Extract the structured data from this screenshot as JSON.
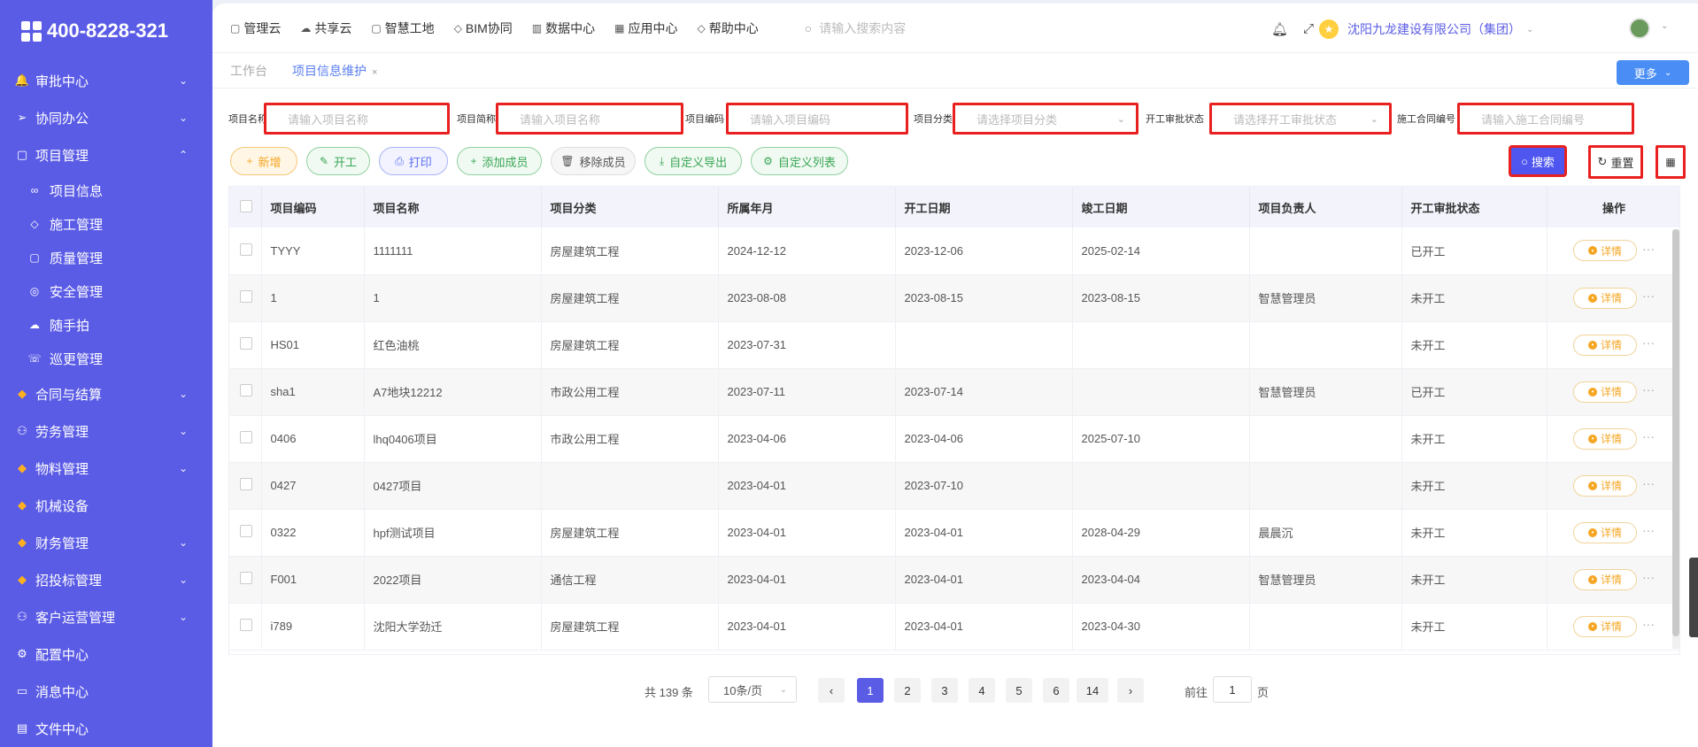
{
  "sidebar": {
    "logo_text": "400-8228-321",
    "menu": [
      {
        "label": "审批中心",
        "icon": "bell-icon",
        "glyph": "🔔",
        "chevron": "⌄"
      },
      {
        "label": "协同办公",
        "icon": "send-icon",
        "glyph": "➢",
        "chevron": "⌄"
      },
      {
        "label": "项目管理",
        "icon": "book-icon",
        "glyph": "▢",
        "chevron": "⌃"
      }
    ],
    "submenu": [
      {
        "label": "项目信息",
        "icon": "glasses-icon",
        "glyph": "∞"
      },
      {
        "label": "施工管理",
        "icon": "tag-icon",
        "glyph": "◇"
      },
      {
        "label": "质量管理",
        "icon": "book-icon",
        "glyph": "▢"
      },
      {
        "label": "安全管理",
        "icon": "location-icon",
        "glyph": "◎"
      },
      {
        "label": "随手拍",
        "icon": "cloud-icon",
        "glyph": "☁"
      },
      {
        "label": "巡更管理",
        "icon": "phone-icon",
        "glyph": "☏"
      }
    ],
    "menu2": [
      {
        "label": "合同与结算",
        "icon": "gem-icon",
        "glyph": "◆",
        "chevron": "⌄"
      },
      {
        "label": "劳务管理",
        "icon": "user-icon",
        "glyph": "⚇",
        "chevron": "⌄"
      },
      {
        "label": "物料管理",
        "icon": "gem-icon",
        "glyph": "◆",
        "chevron": "⌄"
      },
      {
        "label": "机械设备",
        "icon": "gem-icon",
        "glyph": "◆",
        "chevron": ""
      },
      {
        "label": "财务管理",
        "icon": "gem-icon",
        "glyph": "◆",
        "chevron": "⌄"
      },
      {
        "label": "招投标管理",
        "icon": "gem-icon",
        "glyph": "◆",
        "chevron": "⌄"
      },
      {
        "label": "客户运营管理",
        "icon": "user-icon",
        "glyph": "⚇",
        "chevron": "⌄"
      },
      {
        "label": "配置中心",
        "icon": "gear-icon",
        "glyph": "⚙",
        "chevron": ""
      },
      {
        "label": "消息中心",
        "icon": "message-icon",
        "glyph": "▭",
        "chevron": ""
      },
      {
        "label": "文件中心",
        "icon": "file-icon",
        "glyph": "▤",
        "chevron": ""
      }
    ]
  },
  "topnav": {
    "items": [
      "管理云",
      "共享云",
      "智慧工地",
      "BIM协同",
      "数据中心",
      "应用中心",
      "帮助中心"
    ],
    "search_placeholder": "请输入搜索内容",
    "company": "沈阳九龙建设有限公司（集团）"
  },
  "tabs": {
    "workbench": "工作台",
    "active": "项目信息维护",
    "more": "更多"
  },
  "filters": {
    "name_label": "项目名称",
    "name_ph": "请输入项目名称",
    "short_label": "项目简称",
    "short_ph": "请输入项目名称",
    "code_label": "项目编码",
    "code_ph": "请输入项目编码",
    "cat_label": "项目分类",
    "cat_ph": "请选择项目分类",
    "status_label": "开工审批状态",
    "status_ph": "请选择开工审批状态",
    "contract_label": "施工合同编号",
    "contract_ph": "请输入施工合同编号"
  },
  "actions": {
    "add": "新增",
    "start": "开工",
    "print": "打印",
    "add_member": "添加成员",
    "remove_member": "移除成员",
    "export": "自定义导出",
    "custom_list": "自定义列表",
    "search": "搜索",
    "reset": "重置"
  },
  "table": {
    "headers": [
      "项目编码",
      "项目名称",
      "项目分类",
      "所属年月",
      "开工日期",
      "竣工日期",
      "项目负责人",
      "开工审批状态",
      "操作"
    ],
    "detail_label": "详情",
    "rows": [
      [
        "TYYY",
        "1111111",
        "房屋建筑工程",
        "2024-12-12",
        "2023-12-06",
        "2025-02-14",
        "",
        "已开工"
      ],
      [
        "1",
        "1",
        "房屋建筑工程",
        "2023-08-08",
        "2023-08-15",
        "2023-08-15",
        "智慧管理员",
        "未开工"
      ],
      [
        "HS01",
        "红色油桃",
        "房屋建筑工程",
        "2023-07-31",
        "",
        "",
        "",
        "未开工"
      ],
      [
        "sha1",
        "A7地块12212",
        "市政公用工程",
        "2023-07-11",
        "2023-07-14",
        "",
        "智慧管理员",
        "已开工"
      ],
      [
        "0406",
        "lhq0406项目",
        "市政公用工程",
        "2023-04-06",
        "2023-04-06",
        "2025-07-10",
        "",
        "未开工"
      ],
      [
        "0427",
        "0427项目",
        "",
        "2023-04-01",
        "2023-07-10",
        "",
        "",
        "未开工"
      ],
      [
        "0322",
        "hpf测试项目",
        "房屋建筑工程",
        "2023-04-01",
        "2023-04-01",
        "2028-04-29",
        "晨晨沉",
        "未开工"
      ],
      [
        "F001",
        "2022项目",
        "通信工程",
        "2023-04-01",
        "2023-04-01",
        "2023-04-04",
        "智慧管理员",
        "未开工"
      ],
      [
        "i789",
        "沈阳大学劲迁",
        "房屋建筑工程",
        "2023-04-01",
        "2023-04-01",
        "2023-04-30",
        "",
        "未开工"
      ]
    ]
  },
  "pager": {
    "total": "共 139 条",
    "page_size": "10条/页",
    "pages": [
      "1",
      "2",
      "3",
      "4",
      "5",
      "6",
      "···",
      "14"
    ],
    "goto_label": "前往",
    "goto_value": "1",
    "page_suffix": "页"
  }
}
